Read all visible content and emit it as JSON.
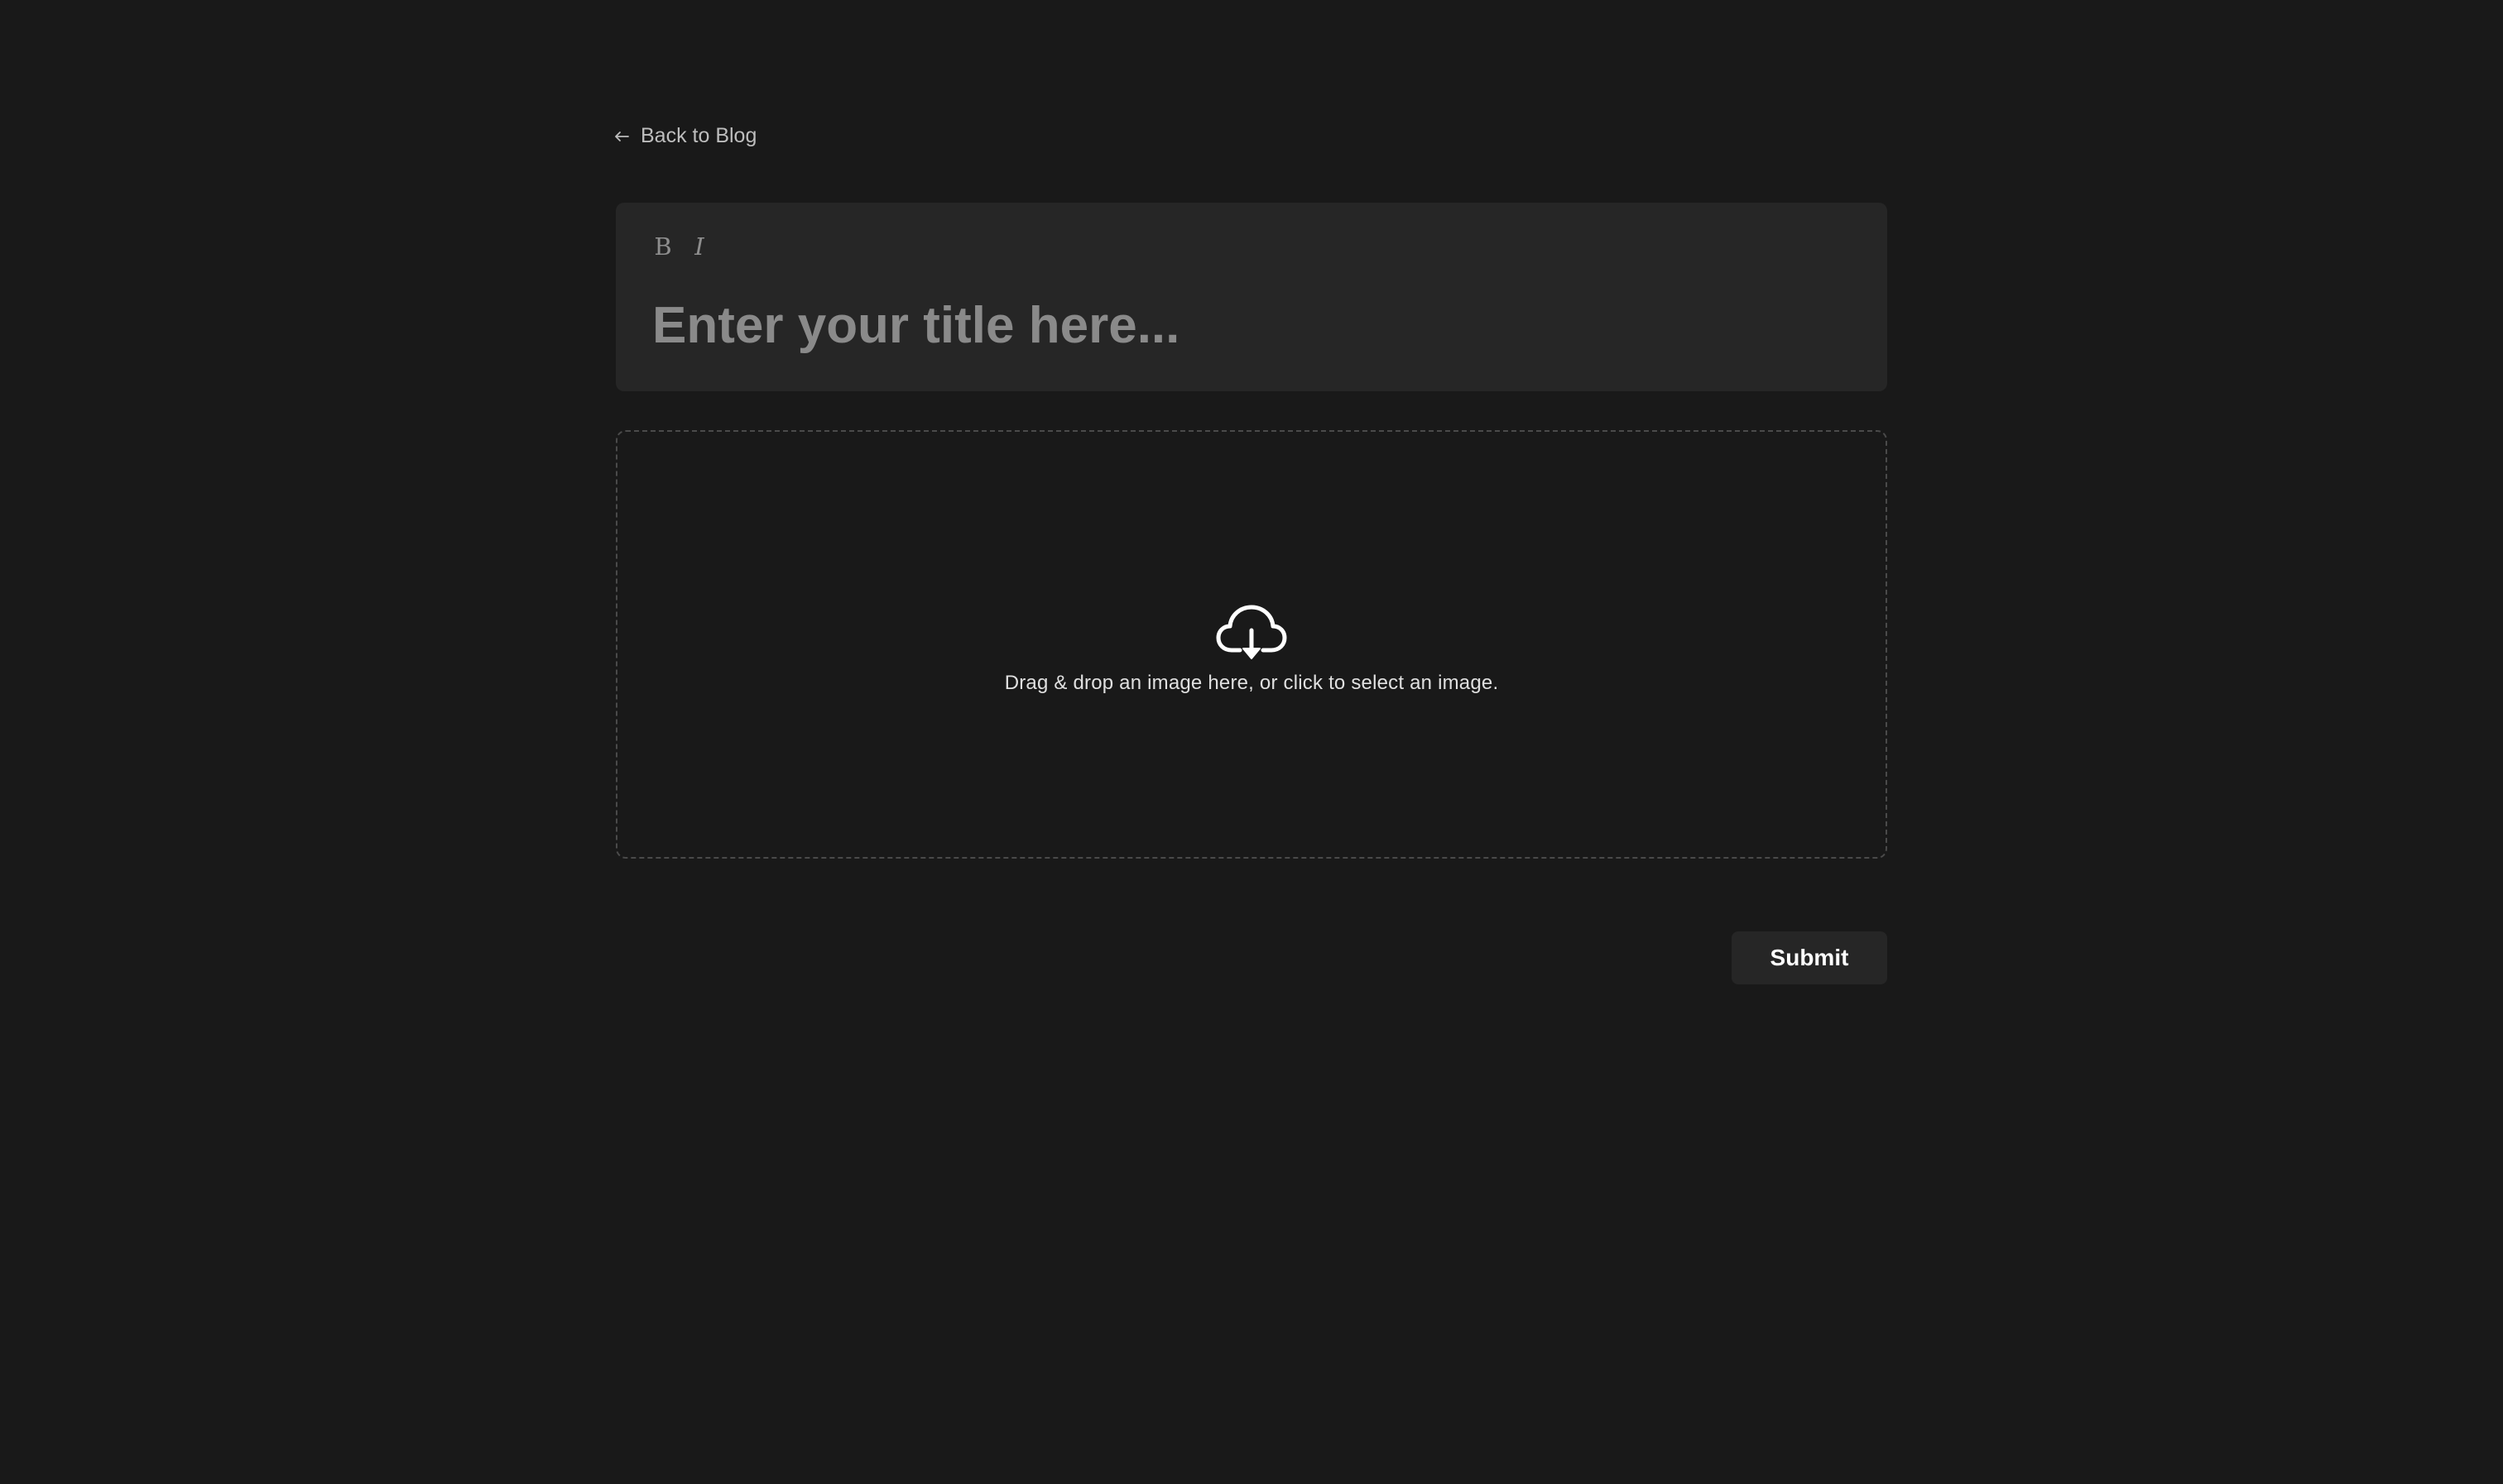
{
  "nav": {
    "back_label": "Back to Blog",
    "back_icon": "arrow-left-icon"
  },
  "editor": {
    "toolbar": {
      "bold_label": "B",
      "italic_label": "I"
    },
    "title": {
      "value": "",
      "placeholder": "Enter your title here..."
    }
  },
  "dropzone": {
    "icon": "cloud-download-icon",
    "text": "Drag & drop an image here, or click to select an image."
  },
  "actions": {
    "submit_label": "Submit"
  },
  "colors": {
    "background": "#191919",
    "panel": "#262626",
    "text_primary": "#ffffff",
    "text_muted": "#8a8a8a",
    "dashed_border": "#4a4a4a"
  }
}
